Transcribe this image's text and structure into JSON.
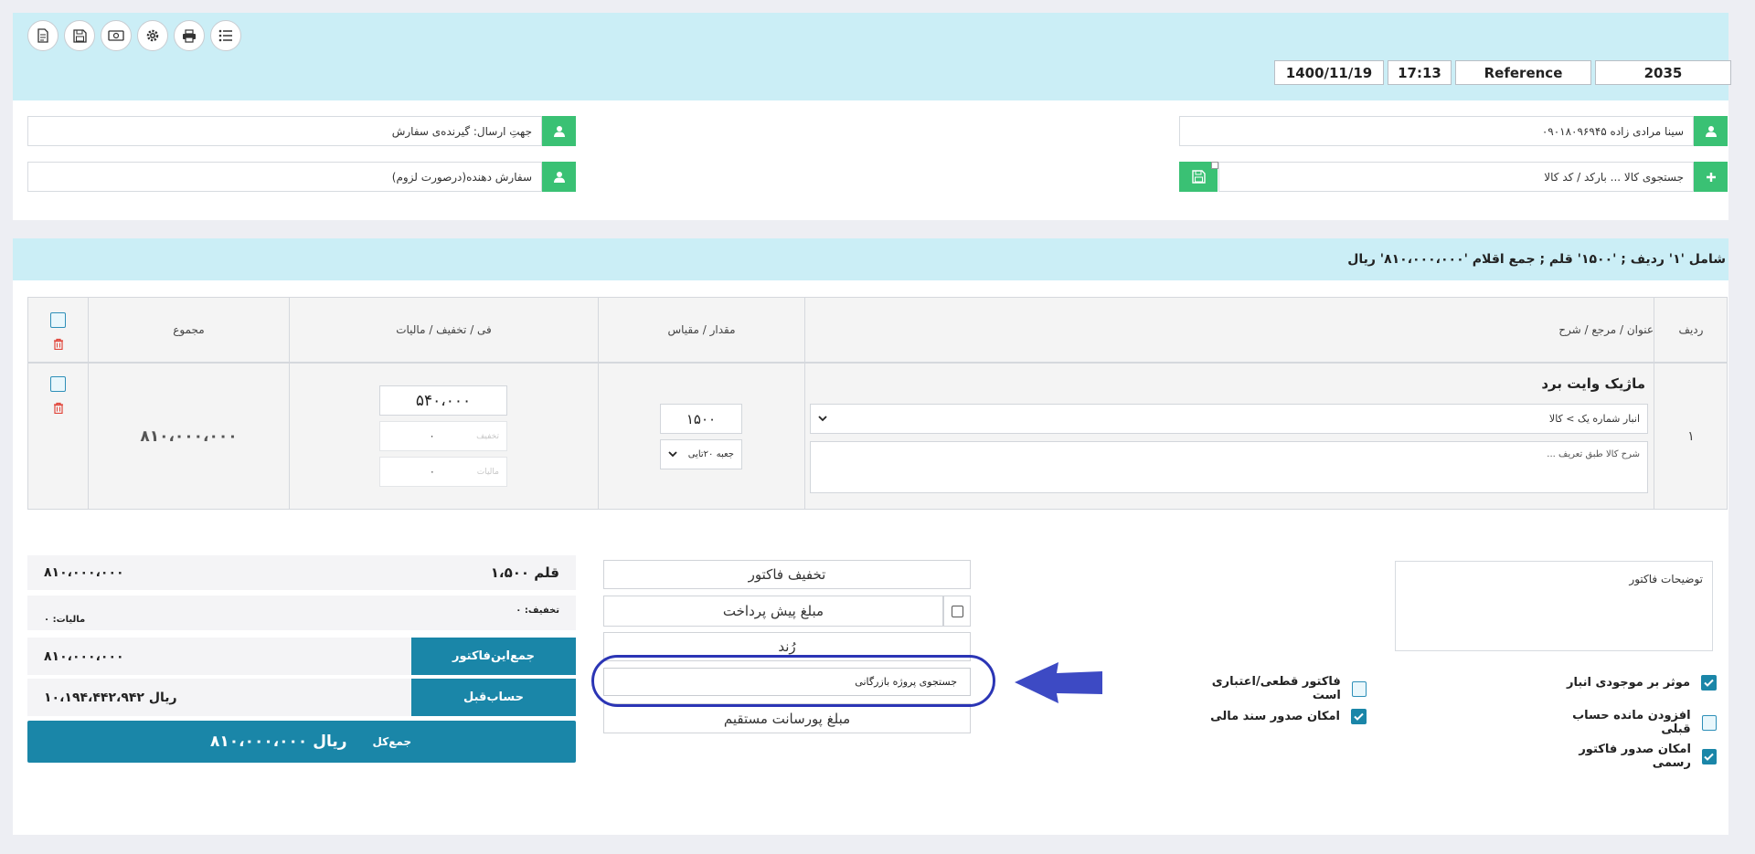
{
  "toolbar": {
    "buttons": [
      "new-document",
      "save",
      "cash",
      "settings",
      "print",
      "list"
    ]
  },
  "header": {
    "date": "1400/11/19",
    "time": "17:13",
    "reference": "Reference",
    "number": "2035"
  },
  "customer": {
    "name_value": "سینا مرادی زاده ۰۹۰۱۸۰۹۶۹۴۵",
    "product_search_placeholder": "جستجوی کالا ... بارکد / کد کالا",
    "send_to_placeholder": "جهتِ ارسال: گیرنده‌ی سفارش",
    "orderer_placeholder": "سفارش دهنده(درصورت لزوم)"
  },
  "summary": "شامل '۱' ردیف ; '۱۵۰۰' قلم ; جمع اقلام '۸۱۰،۰۰۰،۰۰۰' ریال",
  "table": {
    "headers": {
      "row": "ردیف",
      "title": "عنوان / مرجع / شرح",
      "quantity": "مقدار / مقیاس",
      "price": "فی / تخفیف / مالیات",
      "total": "مجموع"
    },
    "rows": [
      {
        "index": "۱",
        "title": "ماژیک وایت برد",
        "warehouse": "انبار شماره یک > کالا",
        "description": "شرح کالا طبق تعریف ...",
        "quantity": "۱۵۰۰",
        "unit": "جعبه ۲۰تایی",
        "price": "۵۴۰،۰۰۰",
        "discount_label": "تخفیف",
        "discount": "۰",
        "tax_label": "مالیات",
        "tax": "۰",
        "total": "۸۱۰،۰۰۰،۰۰۰"
      }
    ]
  },
  "totals": {
    "items_count": "۱،۵۰۰ قلم",
    "items_sum": "۸۱۰،۰۰۰،۰۰۰",
    "discount_text": "تخفیف: ۰",
    "tax_text": "مالیات: ۰",
    "invoice_sum_label": "جمع‌این‌فاکتور",
    "invoice_sum": "۸۱۰،۰۰۰،۰۰۰",
    "prev_account_label": "حساب‌قبل",
    "prev_account": "۱۰،۱۹۴،۴۴۲،۹۴۲ ریال",
    "grand_label": "جمع‌کل",
    "grand_total": "۸۱۰،۰۰۰،۰۰۰ ریال"
  },
  "middle": {
    "invoice_discount": "تخفیف فاکتور",
    "prepayment": "مبلغ پیش پرداخت",
    "round": "رُند",
    "project_search": "جستجوی پروژه بازرگانی",
    "commission": "مبلغ پورسانت مستقیم"
  },
  "notes_label": "توضیحات فاکتور",
  "options": {
    "affects_inventory": "موثر بر موجودی انبار",
    "final_invoice": "فاکتور قطعی/اعتباری است",
    "add_prev_balance": "افزودن مانده حساب قبلی",
    "issue_financial_doc": "امکان صدور سند مالی",
    "issue_official_invoice": "امکان صدور فاکتور رسمی"
  },
  "colors": {
    "header_band": "#cbeef6",
    "green": "#3ac174",
    "teal": "#1a86a8",
    "highlight": "#2b35b5",
    "delete": "#e0453a"
  }
}
